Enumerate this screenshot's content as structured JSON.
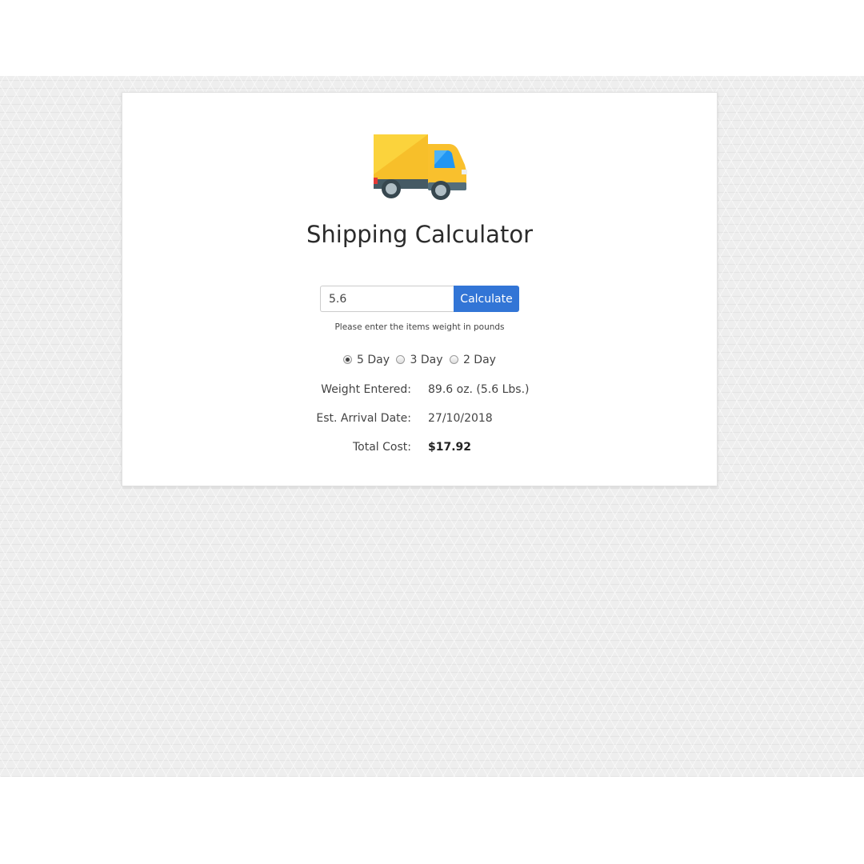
{
  "title": "Shipping Calculator",
  "form": {
    "weight_value": "5.6",
    "calculate_label": "Calculate",
    "hint": "Please enter the items weight in pounds"
  },
  "delivery_options": [
    {
      "label": "5 Day",
      "selected": true
    },
    {
      "label": "3 Day",
      "selected": false
    },
    {
      "label": "2 Day",
      "selected": false
    }
  ],
  "results": {
    "weight": {
      "label": "Weight Entered:",
      "value": "89.6 oz. (5.6 Lbs.)"
    },
    "arrival": {
      "label": "Est. Arrival Date:",
      "value": "27/10/2018"
    },
    "cost": {
      "label": "Total Cost:",
      "value": "$17.92"
    }
  },
  "colors": {
    "accent": "#3275d6",
    "truck_body": "#f9c02d",
    "truck_window": "#29a3ec"
  },
  "icons": {
    "logo": "delivery-truck-icon"
  }
}
